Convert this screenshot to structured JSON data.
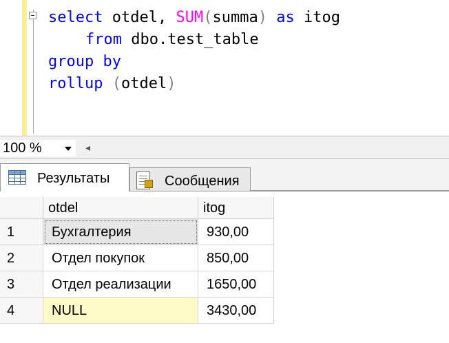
{
  "editor": {
    "line1": {
      "kw1": "select",
      "col1": "otdel,",
      "fn": "SUM",
      "open": "(",
      "arg": "summa",
      "close": ")",
      "kw2": "as",
      "alias": "itog"
    },
    "line2": {
      "kw": "from",
      "table": "dbo.test_table"
    },
    "line3": {
      "kw": "group by"
    },
    "line4": {
      "kw": "rollup",
      "open": "(",
      "arg": "otdel",
      "close": ")"
    }
  },
  "zoom": {
    "value": "100 %"
  },
  "tabs": [
    {
      "label": "Результаты"
    },
    {
      "label": "Сообщения"
    }
  ],
  "results": {
    "columns": [
      "otdel",
      "itog"
    ],
    "rows": [
      {
        "num": "1",
        "otdel": "Бухгалтерия",
        "itog": "930,00"
      },
      {
        "num": "2",
        "otdel": "Отдел покупок",
        "itog": "850,00"
      },
      {
        "num": "3",
        "otdel": "Отдел реализации",
        "itog": "1650,00"
      },
      {
        "num": "4",
        "otdel": "NULL",
        "itog": "3430,00"
      }
    ]
  },
  "colors": {
    "keyword": "#0000ff",
    "function": "#ff00ff",
    "operator": "#808080",
    "null_highlight": "#fffbc8",
    "margin_yellow": "#f7ef96"
  }
}
